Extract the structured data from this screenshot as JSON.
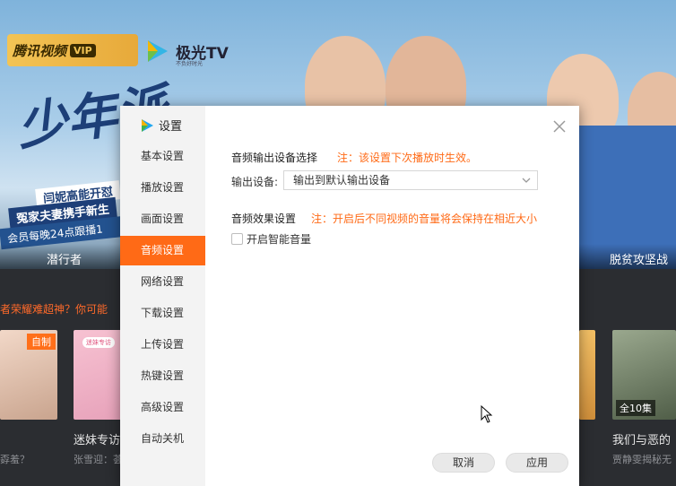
{
  "background": {
    "brand_logo": "腾讯视频",
    "brand_vip": "VIP",
    "partner_logo": "极光TV",
    "partner_slogan": "不负好时光",
    "show_title": "少年派",
    "promo_lines": [
      "闫妮高能开怼",
      "冤家夫妻携手新生",
      "会员每晚24点跟播1"
    ],
    "banner_left_label": "潜行者",
    "banner_right_label": "脱贫攻坚战",
    "ticker": "者荣耀难超神？你可能",
    "thumbs": [
      {
        "badge": "自制",
        "caption": "",
        "sub": "孬羞？"
      },
      {
        "pill": "迷妹专访",
        "caption": "迷妹专访",
        "sub": "张雪迎：荟"
      },
      {
        "caption": "",
        "sub": ""
      },
      {
        "count": "全10集",
        "caption": "我们与恶的",
        "sub": "贾静雯揭秘无"
      }
    ]
  },
  "dialog": {
    "title": "设置",
    "nav": [
      "基本设置",
      "播放设置",
      "画面设置",
      "音频设置",
      "网络设置",
      "下载设置",
      "上传设置",
      "热键设置",
      "高级设置",
      "自动关机"
    ],
    "active_nav": "音频设置",
    "output_section": {
      "heading": "音频输出设备选择",
      "note": "注：该设置下次播放时生效。",
      "label": "输出设备:",
      "selected": "输出到默认输出设备"
    },
    "effect_section": {
      "heading": "音频效果设置",
      "note": "注：开启后不同视频的音量将会保持在相近大小",
      "checkbox_label": "开启智能音量",
      "checked": false
    },
    "cancel_label": "取消",
    "apply_label": "应用"
  },
  "colors": {
    "accent": "#ff6a16",
    "sidebar_bg": "#f3f3f3",
    "app_bg": "#2b2d31"
  }
}
